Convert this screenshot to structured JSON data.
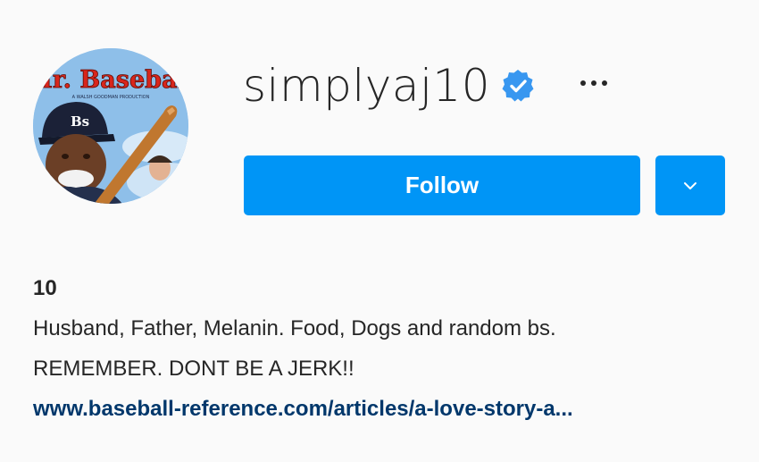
{
  "profile": {
    "username": "simplyaj10",
    "verified": true,
    "more_icon": "more-horizontal-icon",
    "follow_label": "Follow",
    "dropdown_icon": "chevron-down-icon",
    "avatar": {
      "poster_title": "Mr. Baseball",
      "poster_tagline": "A WALSH GOODMAN PRODUCTION",
      "cap_letters": "Bs"
    }
  },
  "bio": {
    "name": "10",
    "line1": "Husband, Father, Melanin. Food, Dogs and random bs.",
    "line2": "REMEMBER. DONT BE A JERK!!",
    "link": "www.baseball-reference.com/articles/a-love-story-a..."
  },
  "colors": {
    "accent": "#0095f6",
    "link": "#00376b",
    "text": "#262626",
    "background": "#fafafa",
    "verified": "#3897f0"
  }
}
